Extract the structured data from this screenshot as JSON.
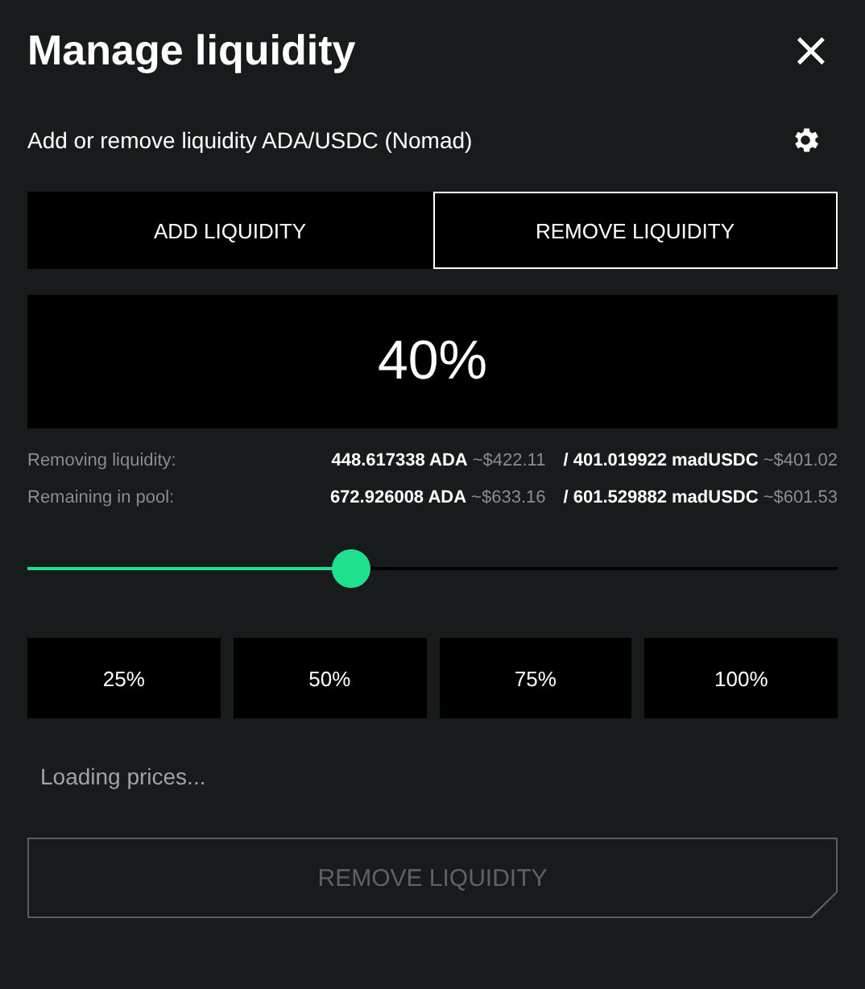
{
  "title": "Manage liquidity",
  "close": "×",
  "subtitle": "Add or remove liquidity ADA/USDC (Nomad)",
  "tabs": [
    {
      "label": "ADD LIQUIDITY",
      "selected": false
    },
    {
      "label": "REMOVE LIQUIDITY",
      "selected": true
    }
  ],
  "percent_display": "40%",
  "summary": [
    {
      "label": "Removing liquidity:",
      "amount_a": "448.617338 ADA",
      "usd_a": "~$422.11",
      "amount_b": "/ 401.019922 madUSDC",
      "usd_b": "~$401.02"
    },
    {
      "label": "Remaining in pool:",
      "amount_a": "672.926008 ADA",
      "usd_a": "~$633.16",
      "amount_b": "/ 601.529882 madUSDC",
      "usd_b": "~$601.53"
    }
  ],
  "slider": {
    "level": 0.4
  },
  "presets": [
    "25%",
    "50%",
    "75%",
    "100%"
  ],
  "status": "Loading prices...",
  "submit": {
    "label": "REMOVE LIQUIDITY",
    "disabled": true
  }
}
